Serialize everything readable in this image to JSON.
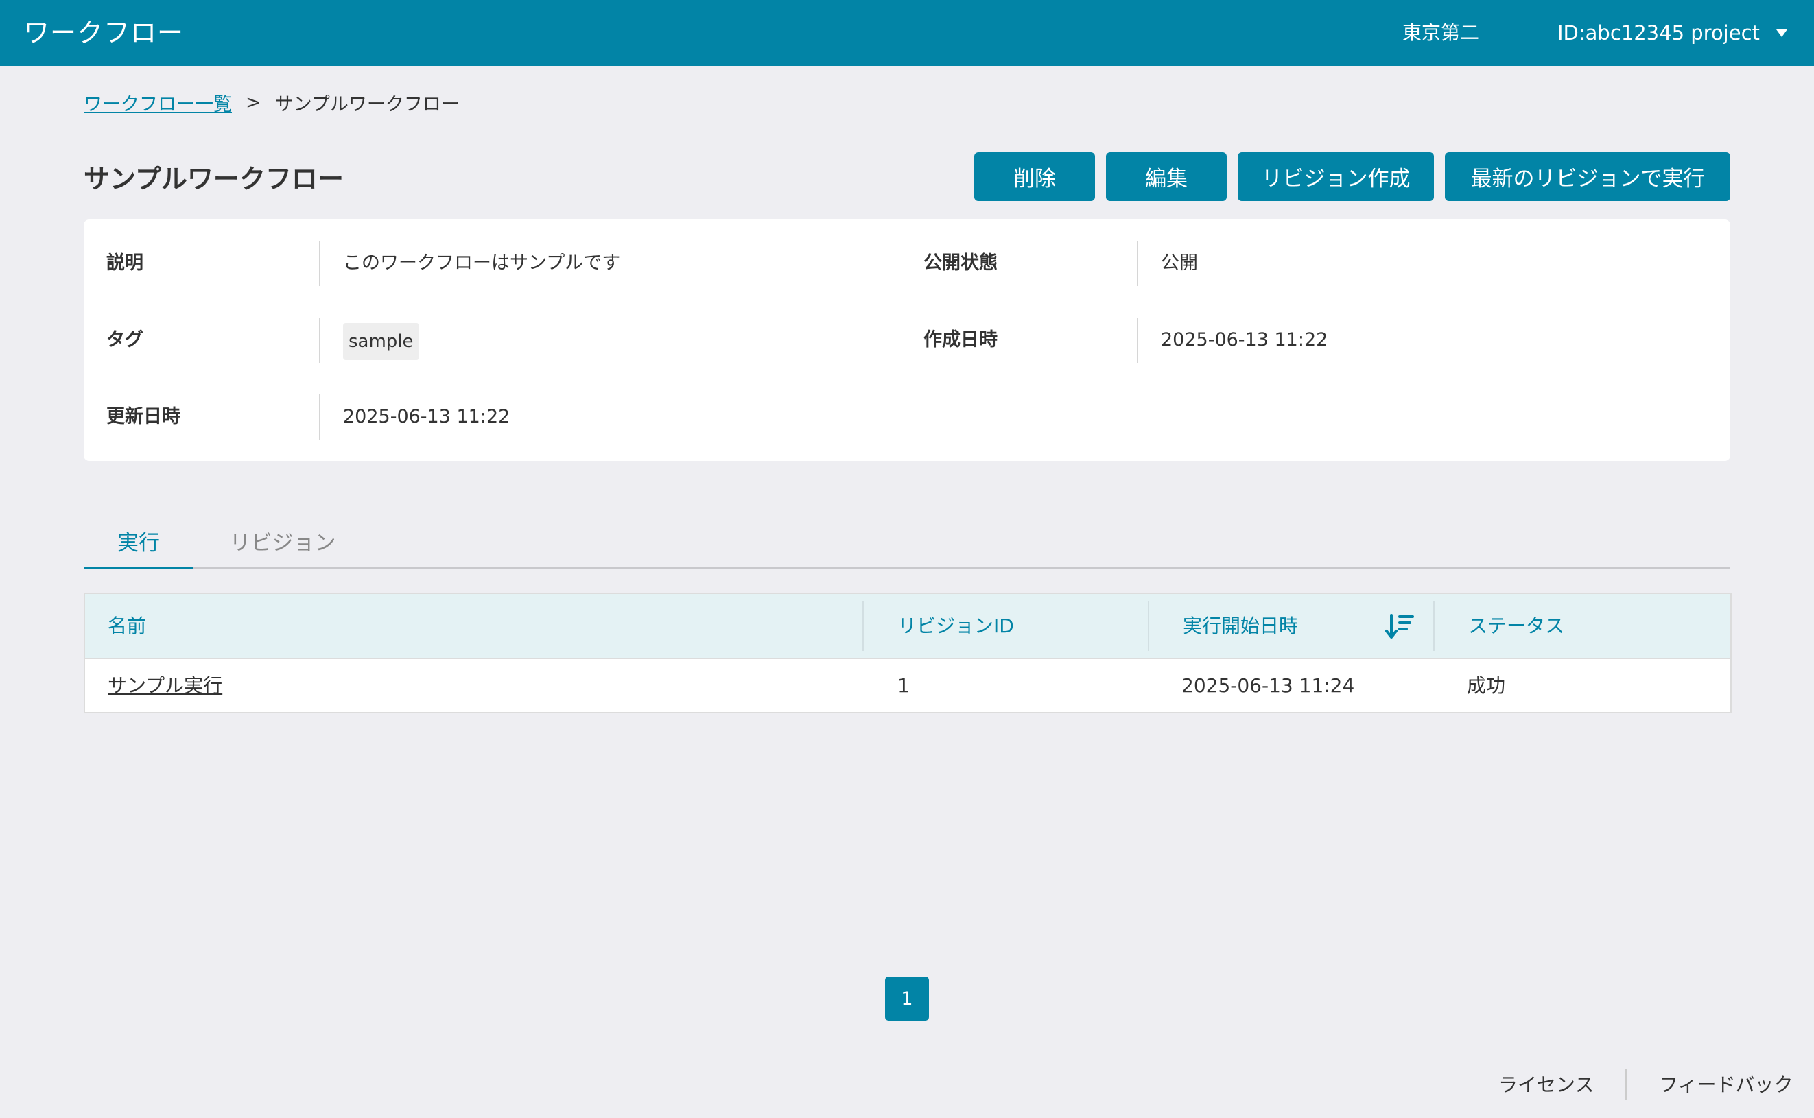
{
  "header": {
    "app_title": "ワークフロー",
    "org_name": "東京第二",
    "project_label": "ID:abc12345 project"
  },
  "breadcrumb": {
    "parent_label": "ワークフロー一覧",
    "separator": ">",
    "current_label": "サンプルワークフロー"
  },
  "page": {
    "title": "サンプルワークフロー"
  },
  "actions": {
    "delete_label": "削除",
    "edit_label": "編集",
    "create_revision_label": "リビジョン作成",
    "run_latest_label": "最新のリビジョンで実行"
  },
  "details": {
    "description_label": "説明",
    "description_value": "このワークフローはサンプルです",
    "visibility_label": "公開状態",
    "visibility_value": "公開",
    "tags_label": "タグ",
    "tags": [
      "sample"
    ],
    "created_label": "作成日時",
    "created_value": "2025-06-13 11:22",
    "updated_label": "更新日時",
    "updated_value": "2025-06-13 11:22"
  },
  "tabs": [
    {
      "label": "実行",
      "active": true
    },
    {
      "label": "リビジョン",
      "active": false
    }
  ],
  "table": {
    "columns": [
      "名前",
      "リビジョンID",
      "実行開始日時",
      "ステータス"
    ],
    "sort_column_icon": "sort-descending-icon",
    "rows": [
      {
        "name": "サンプル実行",
        "revision_id": "1",
        "started_at": "2025-06-13 11:24",
        "status": "成功"
      }
    ]
  },
  "pagination": {
    "current_page": "1"
  },
  "footer": {
    "license_label": "ライセンス",
    "feedback_label": "フィードバック"
  },
  "colors": {
    "primary": "#0284a6",
    "page_background": "#eeeef2",
    "table_header_background": "#e4f2f4"
  }
}
